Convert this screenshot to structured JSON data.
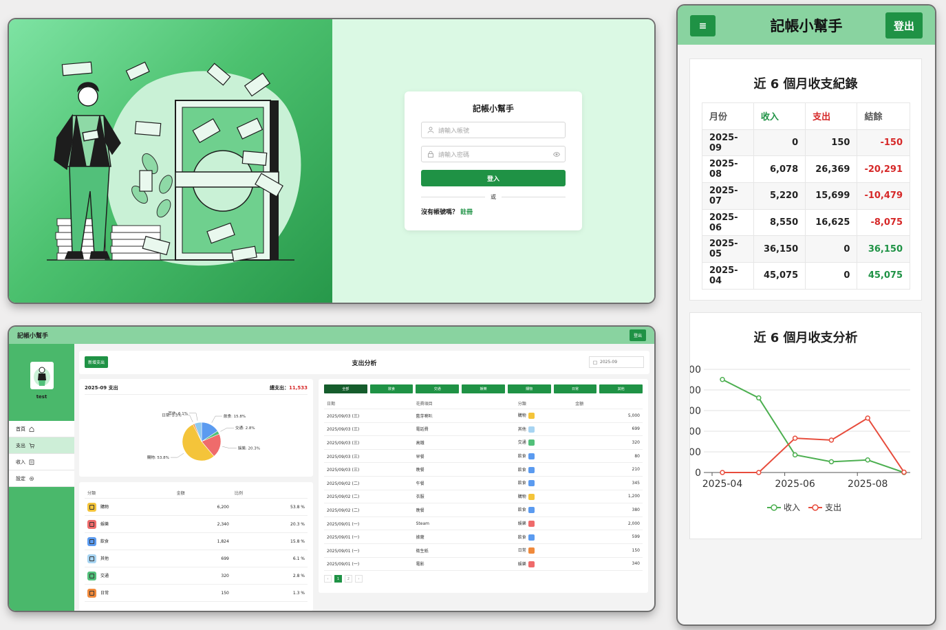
{
  "login": {
    "title": "記帳小幫手",
    "username_placeholder": "請輸入帳號",
    "password_placeholder": "請輸入密碼",
    "login_button": "登入",
    "or_text": "或",
    "no_account_text": "沒有帳號嗎？",
    "register_link": "註冊",
    "colors": {
      "primary": "#1f9245",
      "art_start": "#7ee3a3",
      "art_end": "#27984a",
      "panel_bg": "#dbf9e4"
    }
  },
  "dashboard": {
    "brand": "記帳小幫手",
    "logout": "登出",
    "user": {
      "name": "test"
    },
    "sidebar": [
      {
        "label": "首頁",
        "icon": "home-icon"
      },
      {
        "label": "支出",
        "icon": "cart-icon",
        "active": true
      },
      {
        "label": "收入",
        "icon": "ledger-icon"
      },
      {
        "label": "設定",
        "icon": "gear-icon"
      }
    ],
    "add_button": "新增支出",
    "page_title": "支出分析",
    "month_value": "2025-09",
    "summary": {
      "title": "2025-09 支出",
      "total_label": "總支出：",
      "total_value": "11,533"
    },
    "pie_labels": [
      {
        "label": "飲食: 15.8%"
      },
      {
        "label": "交通: 2.8%"
      },
      {
        "label": "娛樂: 20.3%"
      },
      {
        "label": "購物: 53.8%"
      },
      {
        "label": "日常: 1.3%"
      },
      {
        "label": "其他: 6.1%"
      }
    ],
    "chart_data": {
      "type": "pie",
      "categories": [
        "飲食",
        "交通",
        "娛樂",
        "購物",
        "日常",
        "其他"
      ],
      "values": [
        15.8,
        2.8,
        20.3,
        53.8,
        1.3,
        6.1
      ],
      "colors": [
        "#5b9bf0",
        "#52c07a",
        "#ef6b6b",
        "#f4c43a",
        "#f08a3c",
        "#8fc9ef"
      ]
    },
    "category_table": {
      "headers": [
        "分類",
        "金額",
        "比例"
      ],
      "rows": [
        {
          "name": "購物",
          "amount": "6,200",
          "pct": "53.8 %",
          "color": "#f4c43a",
          "icon": "bag-icon"
        },
        {
          "name": "娛樂",
          "amount": "2,340",
          "pct": "20.3 %",
          "color": "#ef6b6b",
          "icon": "gamepad-icon"
        },
        {
          "name": "飲食",
          "amount": "1,824",
          "pct": "15.8 %",
          "color": "#5b9bf0",
          "icon": "utensils-icon"
        },
        {
          "name": "其他",
          "amount": "699",
          "pct": "6.1 %",
          "color": "#a7d4f2",
          "icon": "file-icon"
        },
        {
          "name": "交通",
          "amount": "320",
          "pct": "2.8 %",
          "color": "#52c07a",
          "icon": "bus-icon"
        },
        {
          "name": "日常",
          "amount": "150",
          "pct": "1.3 %",
          "color": "#f08a3c",
          "icon": "box-icon"
        }
      ]
    },
    "filters": [
      "全部",
      "飲食",
      "交通",
      "娛樂",
      "購物",
      "日常",
      "其他"
    ],
    "expense_table": {
      "headers": [
        "日期",
        "花費項目",
        "分類",
        "金額"
      ],
      "rows": [
        {
          "date": "2025/09/03 (三)",
          "item": "藍芽喇叭",
          "cat": "購物",
          "amount": "5,000",
          "color": "#f4c43a"
        },
        {
          "date": "2025/09/03 (三)",
          "item": "電話費",
          "cat": "其他",
          "amount": "699",
          "color": "#a7d4f2"
        },
        {
          "date": "2025/09/03 (三)",
          "item": "高鐵",
          "cat": "交通",
          "amount": "320",
          "color": "#52c07a"
        },
        {
          "date": "2025/09/03 (三)",
          "item": "早餐",
          "cat": "飲食",
          "amount": "80",
          "color": "#5b9bf0"
        },
        {
          "date": "2025/09/03 (三)",
          "item": "晚餐",
          "cat": "飲食",
          "amount": "210",
          "color": "#5b9bf0"
        },
        {
          "date": "2025/09/02 (二)",
          "item": "午餐",
          "cat": "飲食",
          "amount": "345",
          "color": "#5b9bf0"
        },
        {
          "date": "2025/09/02 (二)",
          "item": "衣服",
          "cat": "購物",
          "amount": "1,200",
          "color": "#f4c43a"
        },
        {
          "date": "2025/09/02 (二)",
          "item": "晚餐",
          "cat": "飲食",
          "amount": "380",
          "color": "#5b9bf0"
        },
        {
          "date": "2025/09/01 (一)",
          "item": "Steam",
          "cat": "娛樂",
          "amount": "2,000",
          "color": "#ef6b6b"
        },
        {
          "date": "2025/09/01 (一)",
          "item": "披薩",
          "cat": "飲食",
          "amount": "599",
          "color": "#5b9bf0"
        },
        {
          "date": "2025/09/01 (一)",
          "item": "衛生紙",
          "cat": "日常",
          "amount": "150",
          "color": "#f08a3c"
        },
        {
          "date": "2025/09/01 (一)",
          "item": "電影",
          "cat": "娛樂",
          "amount": "340",
          "color": "#ef6b6b"
        }
      ]
    },
    "pagination": {
      "prev": "‹",
      "pages": [
        "1",
        "2"
      ],
      "next": "›",
      "current": "1"
    }
  },
  "mobile": {
    "menu_icon": "≡",
    "title": "記帳小幫手",
    "logout": "登出",
    "records_title": "近 6 個月收支紀錄",
    "records_headers": [
      "月份",
      "收入",
      "支出",
      "結餘"
    ],
    "records": [
      {
        "month": "2025-09",
        "income": "0",
        "expense": "150",
        "balance": "-150"
      },
      {
        "month": "2025-08",
        "income": "6,078",
        "expense": "26,369",
        "balance": "-20,291"
      },
      {
        "month": "2025-07",
        "income": "5,220",
        "expense": "15,699",
        "balance": "-10,479"
      },
      {
        "month": "2025-06",
        "income": "8,550",
        "expense": "16,625",
        "balance": "-8,075"
      },
      {
        "month": "2025-05",
        "income": "36,150",
        "expense": "0",
        "balance": "36,150"
      },
      {
        "month": "2025-04",
        "income": "45,075",
        "expense": "0",
        "balance": "45,075"
      }
    ],
    "chart_title": "近 6 個月收支分析",
    "chart_data": {
      "type": "line",
      "x": [
        "2025-04",
        "2025-05",
        "2025-06",
        "2025-07",
        "2025-08",
        "2025-09"
      ],
      "x_tick_labels": [
        "2025-04",
        "2025-06",
        "2025-08"
      ],
      "y_tick_labels": [
        "0",
        "00",
        "00",
        "00",
        "00",
        "00"
      ],
      "series": [
        {
          "name": "收入",
          "values": [
            45075,
            36150,
            8550,
            5220,
            6078,
            0
          ],
          "color": "#4caf50"
        },
        {
          "name": "支出",
          "values": [
            0,
            0,
            16625,
            15699,
            26369,
            150
          ],
          "color": "#e74c3c"
        }
      ],
      "ylim": [
        0,
        50000
      ],
      "grid": true,
      "legend": "bottom"
    }
  }
}
